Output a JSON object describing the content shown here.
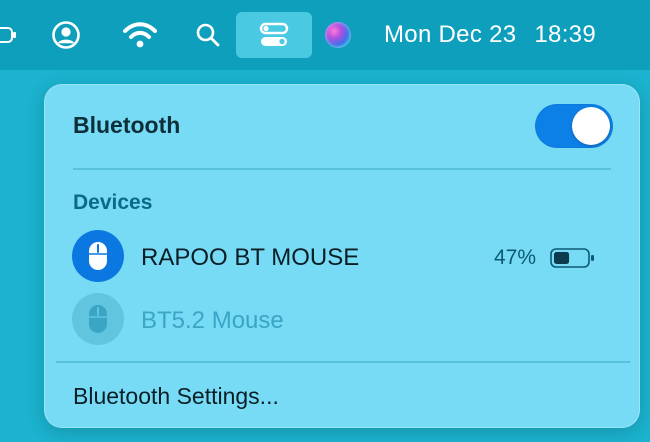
{
  "menubar": {
    "icons": [
      "battery-icon",
      "user-icon",
      "wifi-icon",
      "search-icon",
      "control-center-icon",
      "siri-icon"
    ],
    "day_date": "Mon Dec 23",
    "time": "18:39",
    "colors": {
      "bar": "#0e9fbd",
      "highlight": "#49c9e2"
    }
  },
  "panel": {
    "title": "Bluetooth",
    "toggle_on": true,
    "devices_header": "Devices",
    "devices": [
      {
        "name": "RAPOO BT MOUSE",
        "connected": true,
        "battery": "47%",
        "battery_level": 0.47,
        "icon": "mouse-icon"
      },
      {
        "name": "BT5.2 Mouse",
        "connected": false,
        "icon": "mouse-icon"
      }
    ],
    "settings_label": "Bluetooth Settings...",
    "colors": {
      "background": "#78dbf6",
      "accent": "#0d80e8"
    }
  }
}
